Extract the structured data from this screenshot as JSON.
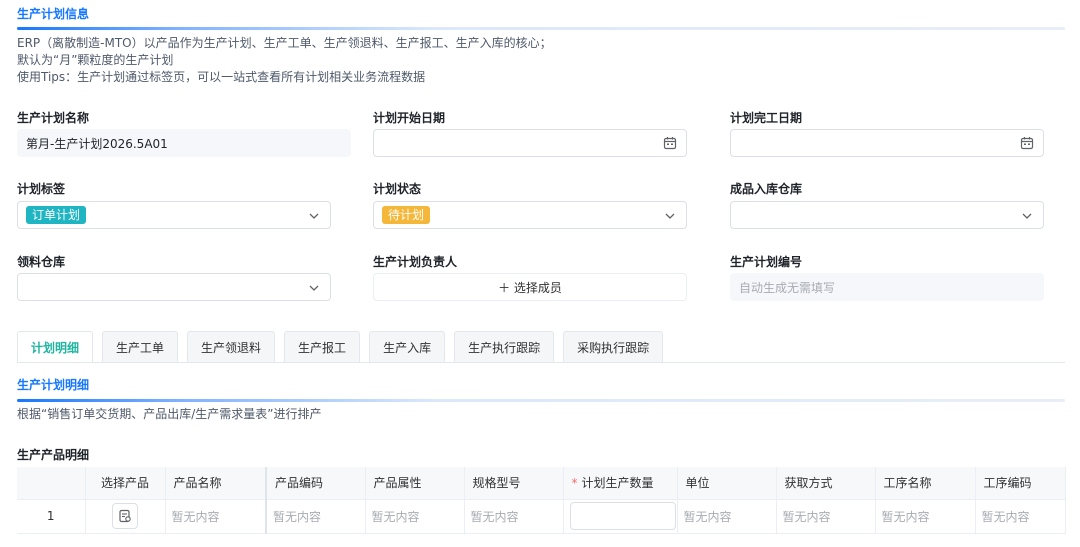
{
  "section1": {
    "title": "生产计划信息",
    "desc": [
      "ERP（离散制造-MTO）以产品作为生产计划、生产工单、生产领退料、生产报工、生产入库的核心；",
      "默认为“月”颗粒度的生产计划",
      "使用Tips：生产计划通过标签页，可以一站式查看所有计划相关业务流程数据"
    ]
  },
  "fields": {
    "plan_name": {
      "label": "生产计划名称",
      "value": "第月-生产计划2026.5A01"
    },
    "start_date": {
      "label": "计划开始日期",
      "value": ""
    },
    "end_date": {
      "label": "计划完工日期",
      "value": ""
    },
    "plan_tag": {
      "label": "计划标签",
      "value": "订单计划",
      "color": "#1fb5c3"
    },
    "plan_status": {
      "label": "计划状态",
      "value": "待计划",
      "color": "#f4b73a"
    },
    "finished_warehouse": {
      "label": "成品入库仓库",
      "value": ""
    },
    "material_warehouse": {
      "label": "领料仓库",
      "value": ""
    },
    "owner": {
      "label": "生产计划负责人",
      "button": "＋ 选择成员"
    },
    "plan_no": {
      "label": "生产计划编号",
      "placeholder": "自动生成无需填写"
    }
  },
  "tabs": [
    "计划明细",
    "生产工单",
    "生产领退料",
    "生产报工",
    "生产入库",
    "生产执行跟踪",
    "采购执行跟踪"
  ],
  "section2": {
    "title": "生产计划明细",
    "desc": "根据“销售订单交货期、产品出库/生产需求量表”进行排产",
    "subtitle": "生产产品明细"
  },
  "table": {
    "headers": [
      "",
      "选择产品",
      "产品名称",
      "产品编码",
      "产品属性",
      "规格型号",
      "计划生产数量",
      "单位",
      "获取方式",
      "工序名称",
      "工序编码"
    ],
    "row": {
      "index": "1",
      "empty": "暂无内容"
    }
  },
  "colors": {
    "accent": "#1677ff",
    "active_tab": "#1fb5a0",
    "required": "#f56c6c"
  }
}
